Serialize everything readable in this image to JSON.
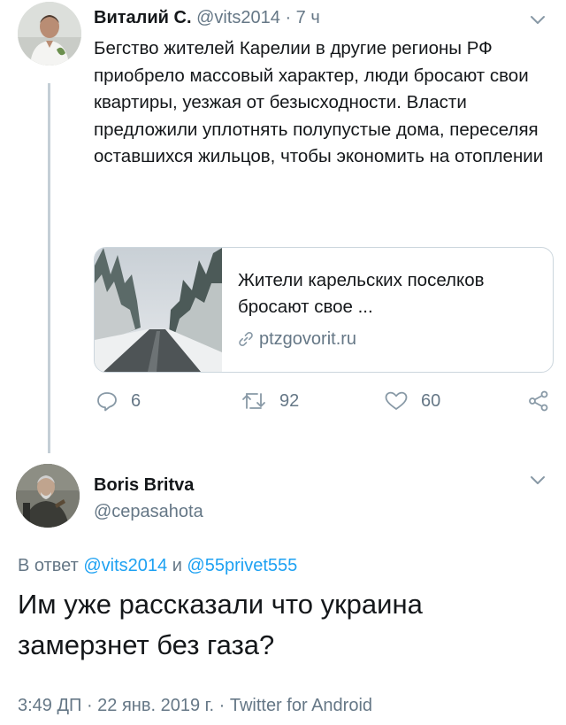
{
  "parent_tweet": {
    "author_name": "Виталий С.",
    "author_handle": "@vits2014",
    "separator": "·",
    "time_ago": "7 ч",
    "text": "Бегство жителей Карелии в другие регионы РФ приобрело массовый характер, люди бросают свои квартиры, уезжая от безысходности. Власти предложили уплотнять полупустые дома, переселяя оставшихся жильцов, чтобы экономить на отоплении",
    "link_card": {
      "title": "Жители карельских поселков бросают свое ...",
      "domain": "ptzgovorit.ru"
    },
    "actions": {
      "replies": "6",
      "retweets": "92",
      "likes": "60"
    },
    "icons": {
      "menu": "chevron-down-icon",
      "reply": "reply-icon",
      "retweet": "retweet-icon",
      "like": "heart-icon",
      "share": "share-icon",
      "link": "link-icon"
    }
  },
  "reply_tweet": {
    "author_name": "Boris Britva",
    "author_handle": "@cepasahota",
    "reply_prefix": "В ответ",
    "mention_1": "@vits2014",
    "conjunction": "и",
    "mention_2": "@55privet555",
    "text": "Им уже рассказали что украина замерзнет без газа?",
    "timestamp": "3:49 ДП · 22 янв. 2019 г. · Twitter for Android"
  },
  "colors": {
    "primary_text": "#14171a",
    "secondary_text": "#657786",
    "link": "#1da1f2",
    "border": "#ccd6dd",
    "thread_line": "#c4cfd6"
  }
}
